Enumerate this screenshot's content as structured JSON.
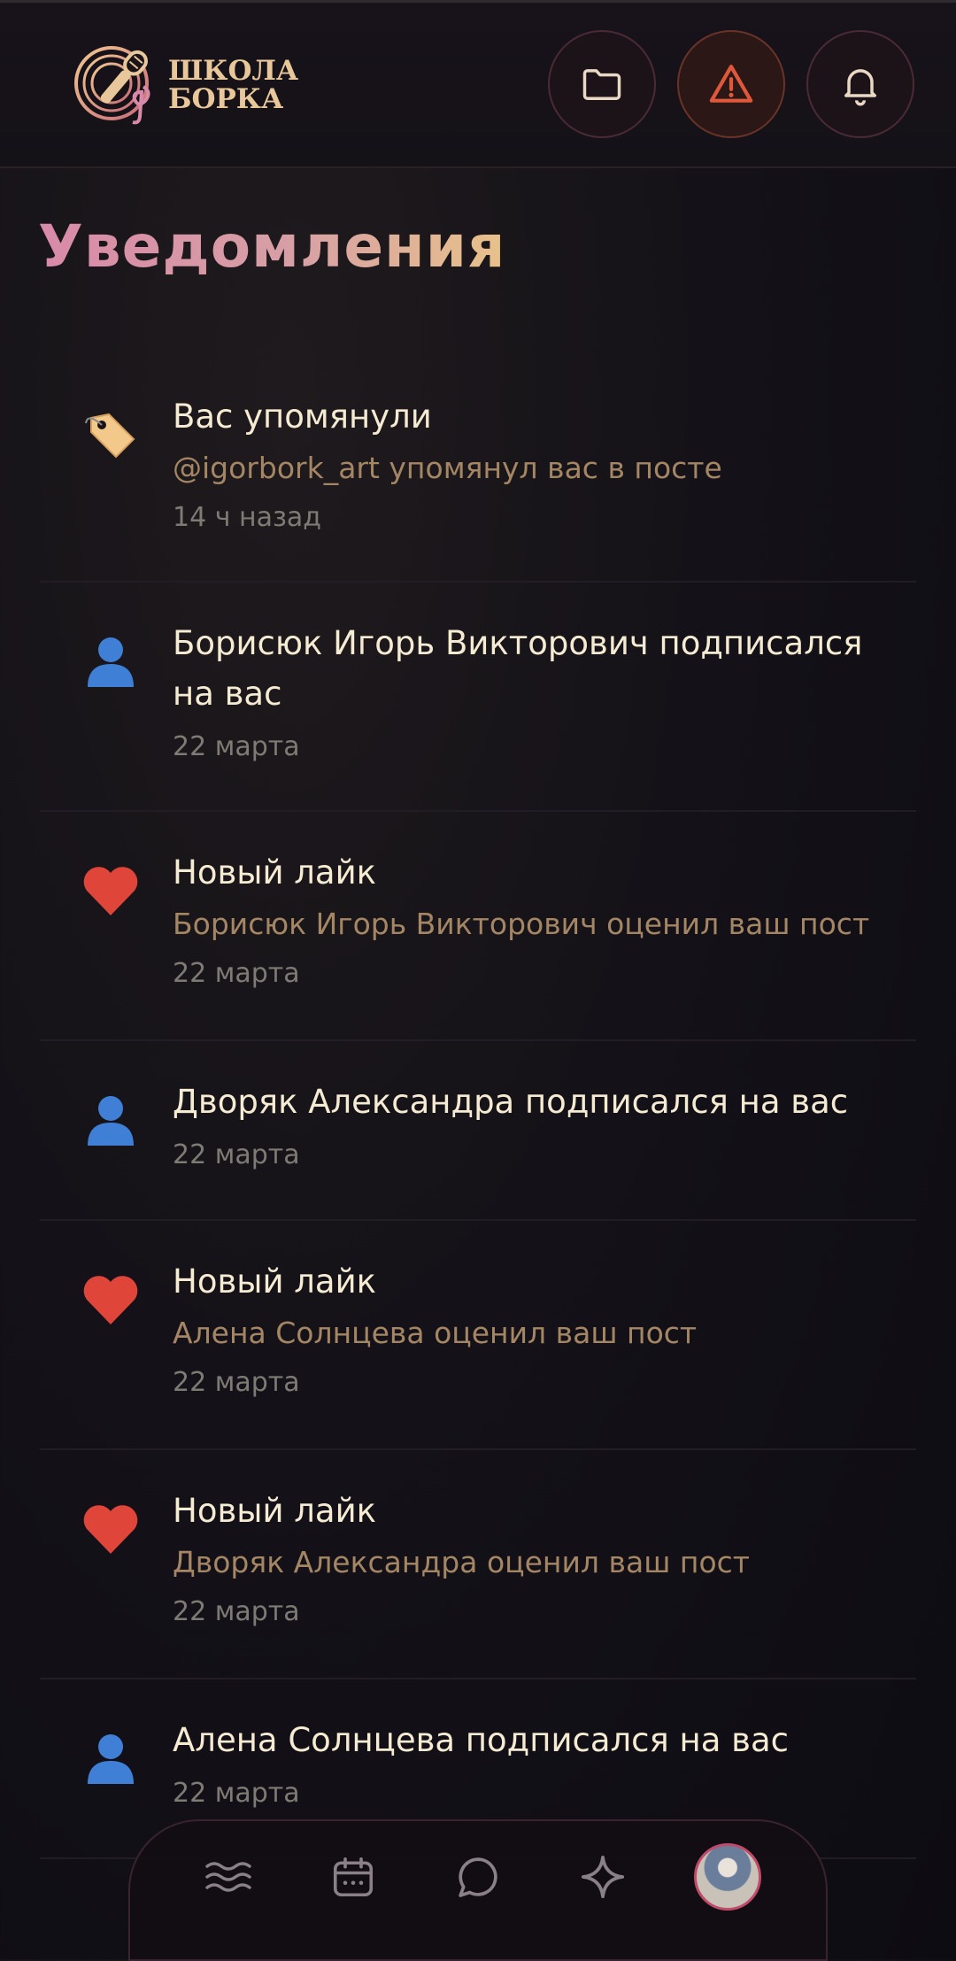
{
  "app": {
    "logo_line1": "ШКОЛА",
    "logo_line2": "БОРКА",
    "top_buttons": [
      "folder-icon",
      "warning-icon",
      "bell-icon"
    ],
    "accent_alert": "#e0583c"
  },
  "page": {
    "title": "Уведомления"
  },
  "notifications": [
    {
      "icon": "tag-icon",
      "title": "Вас упомянули",
      "subtitle": "@igorbork_art упомянул вас в посте",
      "time": "14 ч назад"
    },
    {
      "icon": "user-icon",
      "title": "Борисюк Игорь Викторович подписался на вас",
      "subtitle": "",
      "time": "22 марта"
    },
    {
      "icon": "heart-icon",
      "title": "Новый лайк",
      "subtitle": "Борисюк Игорь Викторович оценил ваш пост",
      "time": "22 марта"
    },
    {
      "icon": "user-icon",
      "title": "Дворяк Александра подписался на вас",
      "subtitle": "",
      "time": "22 марта"
    },
    {
      "icon": "heart-icon",
      "title": "Новый лайк",
      "subtitle": "Алена Солнцева оценил ваш пост",
      "time": "22 марта"
    },
    {
      "icon": "heart-icon",
      "title": "Новый лайк",
      "subtitle": "Дворяк Александра оценил ваш пост",
      "time": "22 марта"
    },
    {
      "icon": "user-icon",
      "title": "Алена Солнцева подписался на вас",
      "subtitle": "",
      "time": "22 марта"
    }
  ],
  "bottom_nav": [
    "waves-icon",
    "calendar-icon",
    "chat-icon",
    "sparkle-icon",
    "avatar"
  ]
}
